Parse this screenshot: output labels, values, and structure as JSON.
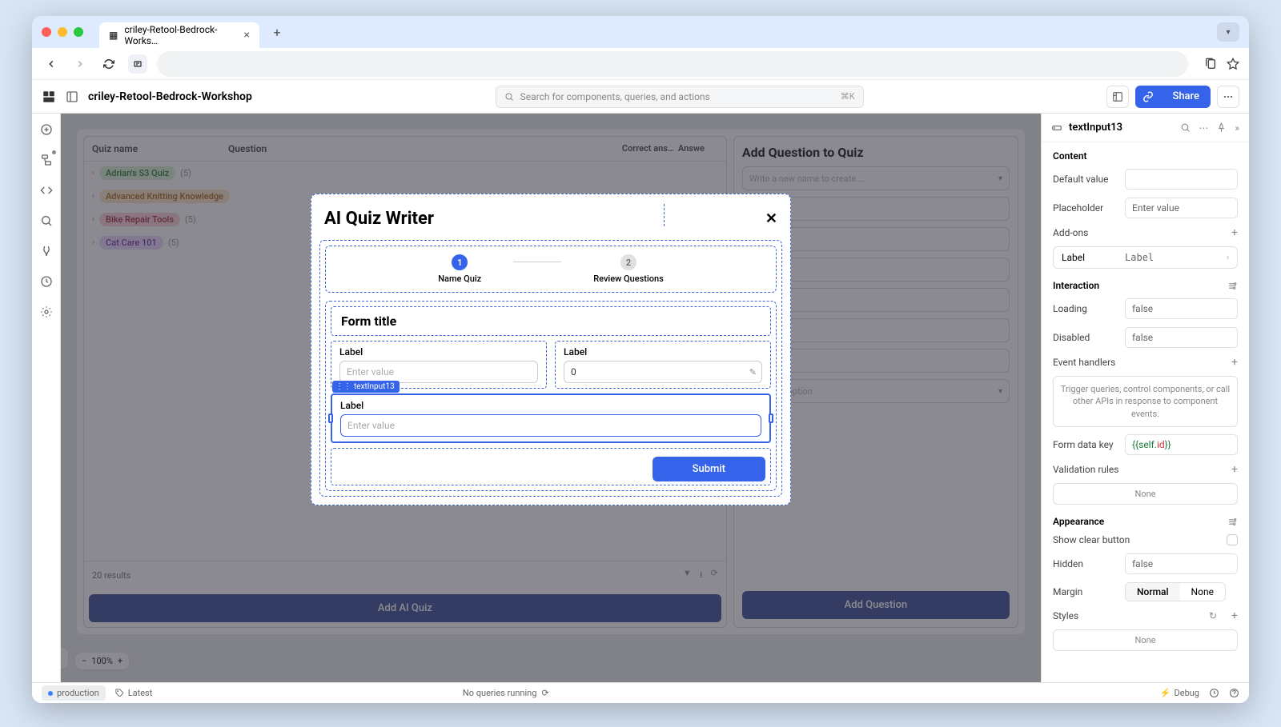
{
  "browser": {
    "tab_title": "criley-Retool-Bedrock-Works…"
  },
  "app": {
    "title": "criley-Retool-Bedrock-Workshop",
    "search_placeholder": "Search for components, queries, and actions",
    "search_kbd": "⌘K",
    "share_label": "Share"
  },
  "table": {
    "headers": {
      "c1": "Quiz name",
      "c2": "Question",
      "c3": "Correct ans…",
      "c4": "Answe"
    },
    "rows": [
      {
        "name": "Adrian's S3 Quiz",
        "count": "(5)",
        "pill_class": "green"
      },
      {
        "name": "Advanced Knitting Knowledge",
        "count": "",
        "pill_class": "orange"
      },
      {
        "name": "Bike Repair Tools",
        "count": "(5)",
        "pill_class": "red"
      },
      {
        "name": "Cat Care 101",
        "count": "(5)",
        "pill_class": "purple"
      }
    ],
    "footer_text": "20 results",
    "add_ai_label": "Add AI Quiz"
  },
  "side_panel": {
    "title": "Add Question to Quiz",
    "select_placeholder": "Write a new name to create …",
    "select_option": "Select an option",
    "add_q_label": "Add Question"
  },
  "modal": {
    "title": "AI Quiz Writer",
    "step1": "Name Quiz",
    "step2": "Review Questions",
    "form_title": "Form title",
    "label": "Label",
    "placeholder": "Enter value",
    "number_value": "0",
    "selected_tag": "textInput13",
    "submit": "Submit"
  },
  "inspector": {
    "component_name": "textInput13",
    "sections": {
      "content": "Content",
      "interaction": "Interaction",
      "appearance": "Appearance"
    },
    "rows": {
      "default_value": "Default value",
      "placeholder": "Placeholder",
      "placeholder_value": "Enter value",
      "addons": "Add-ons",
      "addon_label": "Label",
      "addon_value": "Label",
      "loading": "Loading",
      "loading_value": "false",
      "disabled": "Disabled",
      "disabled_value": "false",
      "event_handlers": "Event handlers",
      "event_help": "Trigger queries, control components, or call other APIs in response to component events.",
      "form_data_key": "Form data key",
      "form_data_value": "{{ self.id }}",
      "validation_rules": "Validation rules",
      "none": "None",
      "show_clear": "Show clear button",
      "hidden": "Hidden",
      "hidden_value": "false",
      "margin": "Margin",
      "margin_normal": "Normal",
      "margin_none": "None",
      "styles": "Styles"
    }
  },
  "status": {
    "env": "production",
    "version": "Latest",
    "queries": "No queries running",
    "debug": "Debug"
  },
  "zoom": {
    "value": "100%"
  }
}
